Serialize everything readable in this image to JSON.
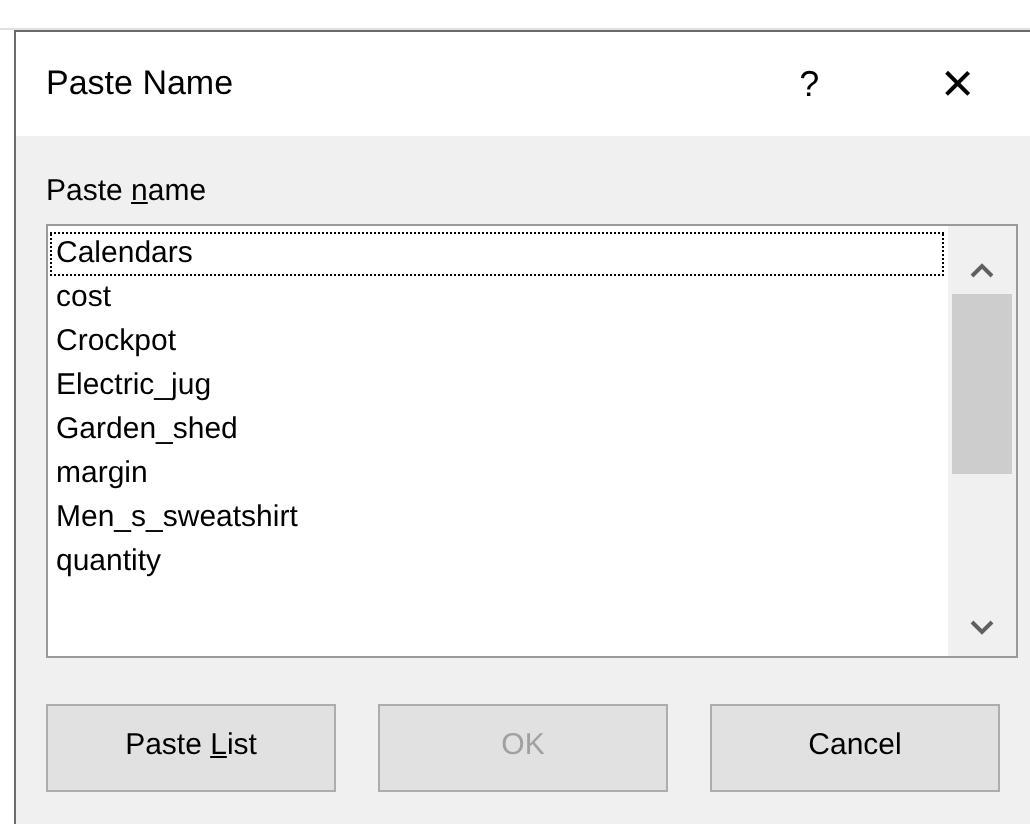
{
  "window": {
    "title": "Paste Name",
    "help": "?",
    "close": "×"
  },
  "list": {
    "label_parts": [
      "Paste ",
      "n",
      "ame"
    ],
    "items": [
      {
        "text": "Calendars",
        "focused": true
      },
      {
        "text": "cost",
        "focused": false
      },
      {
        "text": "Crockpot",
        "focused": false
      },
      {
        "text": "Electric_jug",
        "focused": false
      },
      {
        "text": "Garden_shed",
        "focused": false
      },
      {
        "text": "margin",
        "focused": false
      },
      {
        "text": "Men_s_sweatshirt",
        "focused": false
      },
      {
        "text": "quantity",
        "focused": false
      }
    ]
  },
  "buttons": [
    {
      "label_parts": [
        "Paste ",
        "L",
        "ist"
      ],
      "disabled": false
    },
    {
      "label_parts": [
        "OK"
      ],
      "disabled": true
    },
    {
      "label_parts": [
        "Cancel"
      ],
      "disabled": false
    }
  ]
}
